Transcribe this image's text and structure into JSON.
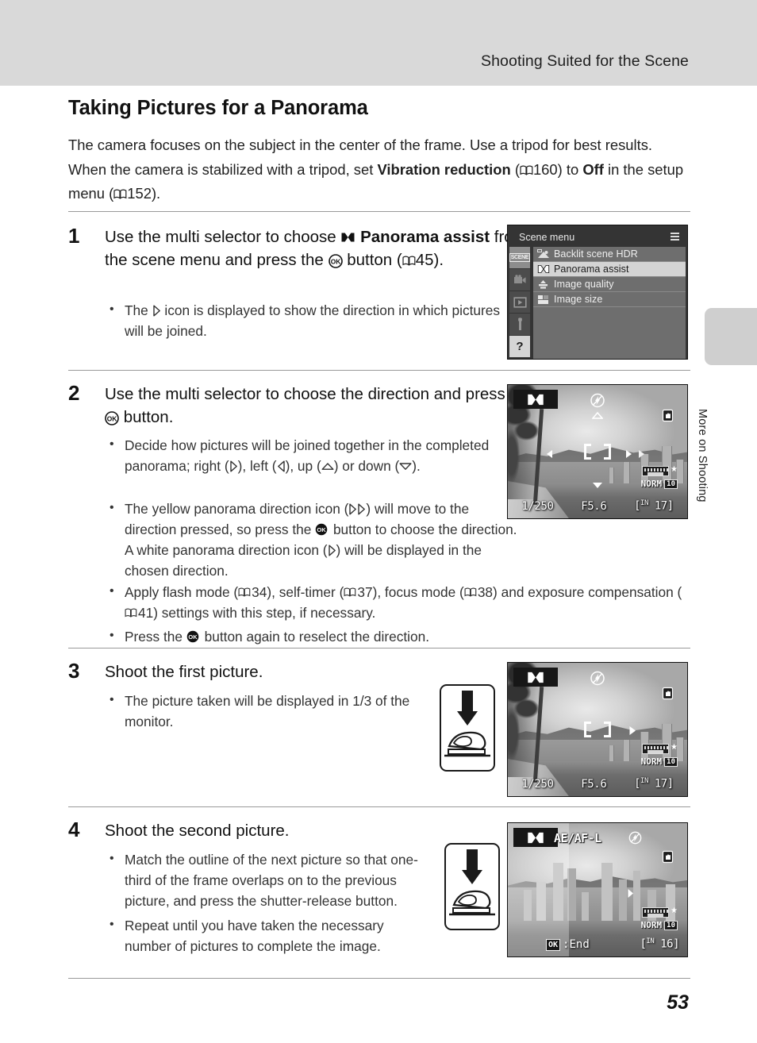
{
  "header": {
    "running_title": "Shooting Suited for the Scene"
  },
  "side_tab": {
    "label": "More on Shooting"
  },
  "page_number": "53",
  "chapter": {
    "title": "Taking Pictures for a Panorama"
  },
  "intro": {
    "part1": "The camera focuses on the subject in the center of the frame. Use a tripod for best results. When the camera is stabilized with a tripod, set ",
    "bold1": "Vibration reduction",
    "part2": " (",
    "ref1": "160",
    "part3": ") to ",
    "bold2": "Off",
    "part4": " in the setup menu (",
    "ref2": "152",
    "part5": ")."
  },
  "steps": [
    {
      "number": "1",
      "head_part1": "Use the multi selector to choose ",
      "head_bold1": "Panorama assist",
      "head_part2": " from the scene menu and press the ",
      "head_part3": " button (",
      "head_ref": "45",
      "head_part4": ").",
      "bullets": [
        {
          "part1": "The ",
          "part2": " icon is displayed to show the direction in which pictures will be joined."
        }
      ]
    },
    {
      "number": "2",
      "head_part1": "Use the multi selector to choose the direction and press the ",
      "head_part2": " button.",
      "bullets": [
        {
          "part1": "Decide how pictures will be joined together in the completed panorama; right (",
          "part2": "), left (",
          "part3": "), up (",
          "part4": ") or down (",
          "part5": ")."
        },
        {
          "part1": "The yellow panorama direction icon (",
          "part2": ") will move to the direction pressed, so press the ",
          "part3": " button to choose the direction. A white panorama direction icon (",
          "part4": ") will be displayed in the chosen direction."
        },
        {
          "part1": "Apply flash mode (",
          "ref1": "34",
          "part2": "), self-timer (",
          "ref2": "37",
          "part3": "), focus mode (",
          "ref3": "38",
          "part4": ") and exposure compensation (",
          "ref4": "41",
          "part5": ") settings with this step, if necessary."
        },
        {
          "part1": "Press the ",
          "part2": " button again to reselect the direction."
        }
      ]
    },
    {
      "number": "3",
      "head_plain": "Shoot the first picture.",
      "bullets": [
        {
          "plain": "The picture taken will be displayed in 1/3 of the monitor."
        }
      ]
    },
    {
      "number": "4",
      "head_plain": "Shoot the second picture.",
      "bullets": [
        {
          "plain": "Match the outline of the next picture so that one-third of the frame overlaps on to the previous picture, and press the shutter-release button."
        },
        {
          "plain": "Repeat until you have taken the necessary number of pictures to complete the image."
        }
      ]
    }
  ],
  "scene_menu_screen": {
    "title": "Scene menu",
    "items": [
      {
        "label": "Backlit scene HDR",
        "icon": "backlit-hdr-icon",
        "selected": false
      },
      {
        "label": "Panorama assist",
        "icon": "panorama-icon",
        "selected": true
      },
      {
        "label": "Image quality",
        "icon": "image-quality-icon",
        "selected": false
      },
      {
        "label": "Image size",
        "icon": "image-size-icon",
        "selected": false
      }
    ],
    "sidebar_tabs": [
      {
        "name": "scene-tab",
        "text": "SCENE",
        "active": true
      },
      {
        "name": "movie-tab",
        "text": "",
        "active": false
      },
      {
        "name": "playback-tab",
        "text": "",
        "active": false
      },
      {
        "name": "setup-tab",
        "text": "",
        "active": false
      },
      {
        "name": "help-tab",
        "text": "?",
        "active": false
      }
    ]
  },
  "lcd_step2": {
    "shutter_speed": "1/250",
    "aperture": "F5.6",
    "shots_prefix": "IN",
    "shots_remaining": "17",
    "quality_label": "NORM",
    "size_label": "10",
    "direction_icons": "left, right, right-yellow, up, down"
  },
  "lcd_step3": {
    "shutter_speed": "1/250",
    "aperture": "F5.6",
    "shots_prefix": "IN",
    "shots_remaining": "17",
    "quality_label": "NORM",
    "size_label": "10",
    "direction_icons": "right-white"
  },
  "lcd_step4": {
    "ae_af_lock": "AE/AF-L",
    "end_key": "OK",
    "end_label": ":End",
    "shots_prefix": "IN",
    "shots_remaining": "16",
    "quality_label": "NORM",
    "size_label": "10"
  },
  "colors": {
    "header_band": "#d9d9d9",
    "side_tab": "#cfcfcf",
    "menu_bg": "#343434",
    "menu_list_bg": "#6e6e6e",
    "menu_selected_bg": "#d4d4d4",
    "rule": "#9a9a9a",
    "text": "#1f1f1f"
  }
}
